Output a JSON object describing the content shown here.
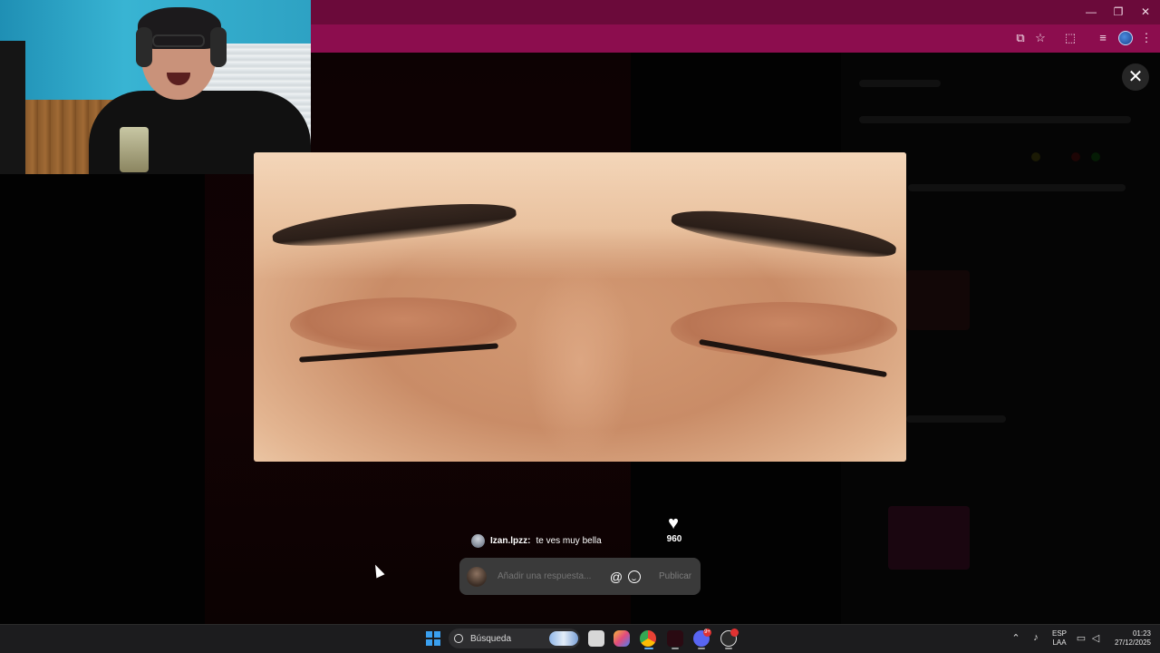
{
  "browser": {
    "window_controls": {
      "minimize": "—",
      "maximize": "❐",
      "close": "✕"
    },
    "toolbar_icons": [
      "install-icon",
      "star-icon",
      "extensions-icon",
      "media-icon",
      "profile-icon",
      "menu-icon"
    ]
  },
  "viewer": {
    "close_label": "✕"
  },
  "comment": {
    "username": "Izan.lpzz:",
    "text": "te ves muy bella"
  },
  "likes": {
    "icon": "heart-icon",
    "count": "960"
  },
  "reply": {
    "placeholder": "Añadir una respuesta...",
    "mention_glyph": "@",
    "post_label": "Publicar"
  },
  "taskbar": {
    "search_label": "Búsqueda",
    "language_line1": "ESP",
    "language_line2": "LAA",
    "time": "01:23",
    "date": "27/12/2025",
    "notification_badge": "9+"
  },
  "colors": {
    "titlebar": "#6b0a3a",
    "toolbar": "#8c0d4e",
    "reply_box": "#3a3a3a",
    "taskbar": "#1c1c1e"
  }
}
